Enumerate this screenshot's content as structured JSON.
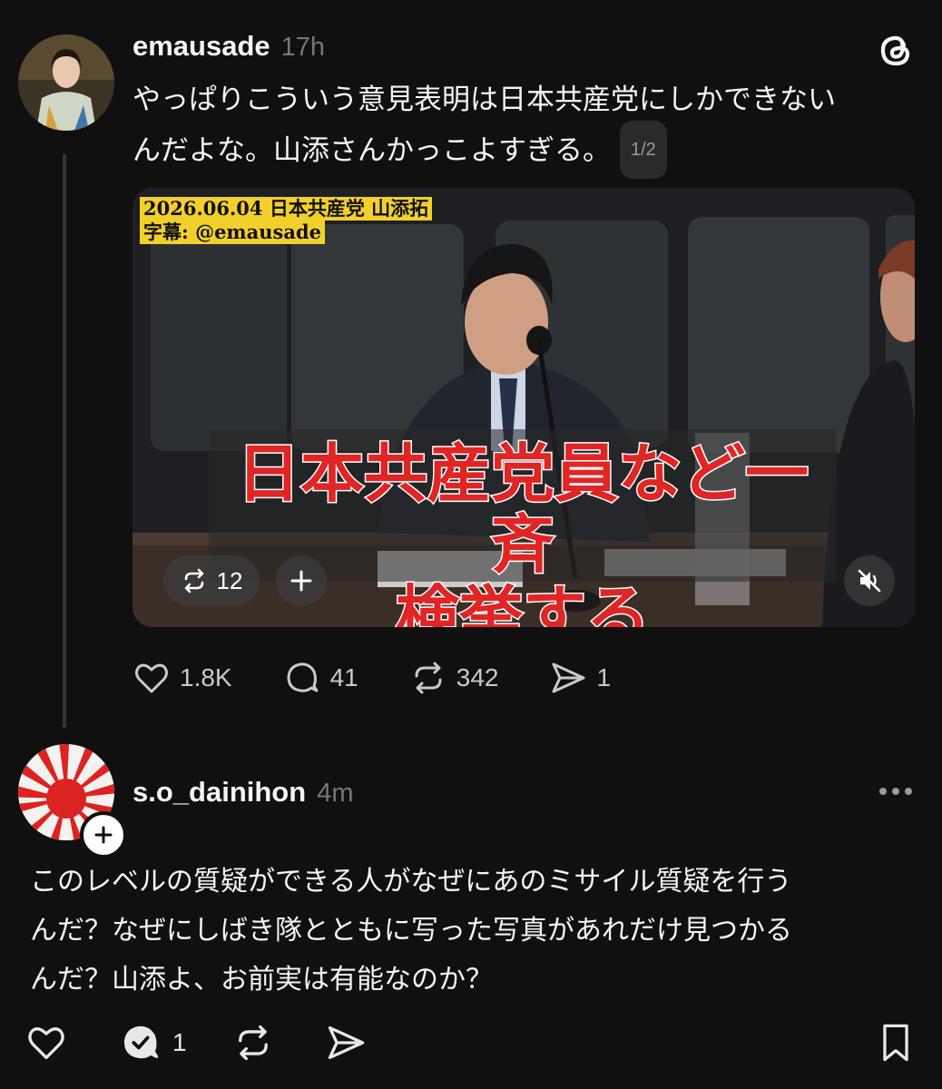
{
  "post": {
    "username": "emausade",
    "time": "17h",
    "text_line1": "やっぱりこういう意見表明は日本共産党にしかできない",
    "text_line2": "んだよな。山添さんかっこよすぎる。",
    "pager": "1/2",
    "video": {
      "caption_date": "2026.06.04 日本共産党 山添拓",
      "caption_credit": "字幕: @emausade",
      "subtitle_line1": "日本共産党員など一斉",
      "subtitle_line2": "検挙する",
      "repost_count": "12"
    },
    "likes": "1.8K",
    "replies": "41",
    "reposts": "342",
    "shares": "1"
  },
  "reply": {
    "username": "s.o_dainihon",
    "time": "4m",
    "text_line1": "このレベルの質疑ができる人がなぜにあのミサイル質疑を行う",
    "text_line2": "んだ？なぜにしばき隊とともに写った写真があれだけ見つかる",
    "text_line3": "んだ？山添よ、お前実は有能なのか？",
    "reply_count": "1"
  },
  "colors": {
    "background": "#101010",
    "text": "#f3f5f7",
    "muted": "#777777",
    "subtitle_red": "#e02525",
    "caption_yellow": "#f2d02b"
  }
}
